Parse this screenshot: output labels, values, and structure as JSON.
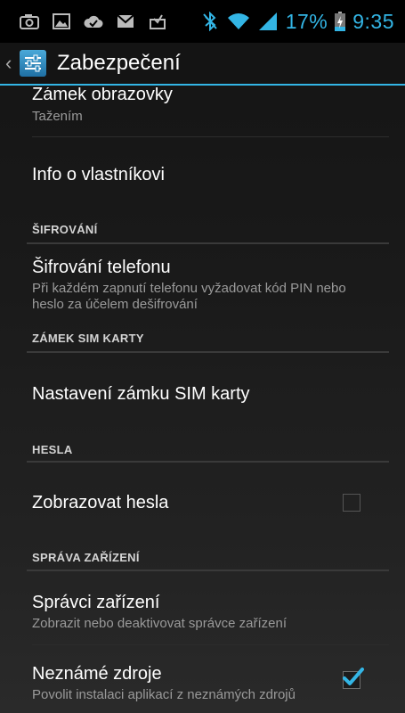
{
  "status_bar": {
    "left_icons": [
      "camera-icon",
      "image-icon",
      "sync-icon",
      "email-icon",
      "download-icon"
    ],
    "battery_percent": "17%",
    "time": "9:35"
  },
  "action_bar": {
    "title": "Zabezpečení"
  },
  "items": {
    "screen_lock_title": "Zámek obrazovky",
    "screen_lock_summary": "Tažením",
    "owner_info_title": "Info o vlastníkovi",
    "encryption_header": "ŠIFROVÁNÍ",
    "phone_encryption_title": "Šifrování telefonu",
    "phone_encryption_summary": "Při každém zapnutí telefonu vyžadovat kód PIN nebo heslo za účelem dešifrování",
    "sim_lock_header": "ZÁMEK SIM KARTY",
    "sim_lock_title": "Nastavení zámku SIM karty",
    "passwords_header": "HESLA",
    "show_passwords_title": "Zobrazovat hesla",
    "device_admin_header": "SPRÁVA ZAŘÍZENÍ",
    "device_admins_title": "Správci zařízení",
    "device_admins_summary": "Zobrazit nebo deaktivovat správce zařízení",
    "unknown_sources_title": "Neznámé zdroje",
    "unknown_sources_summary": "Povolit instalaci aplikací z neznámých zdrojů"
  },
  "checkboxes": {
    "show_passwords_checked": false,
    "unknown_sources_checked": true
  },
  "colors": {
    "accent": "#33b5e5",
    "background": "#1a1a1a",
    "secondary_text": "#9a9a9a"
  }
}
